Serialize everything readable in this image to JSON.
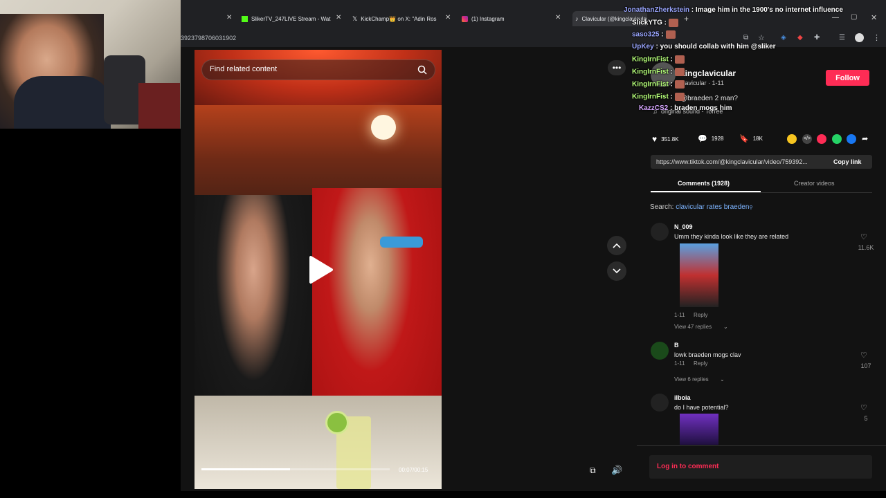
{
  "browser": {
    "tabs": [
      {
        "label": "SlikerTV_247LIVE Stream - Wat",
        "icon": "kick-icon"
      },
      {
        "label": "KickChamp👑 on X: \"Adin Ros",
        "icon": "x-icon"
      },
      {
        "label": "(1) Instagram",
        "icon": "instagram-icon"
      },
      {
        "label": "Clavicular (@kingclavicular)",
        "icon": "tiktok-icon"
      }
    ],
    "url": "3923798706031902"
  },
  "video": {
    "search_placeholder": "Find related content",
    "time": "00:07/00:15",
    "progress_fraction": 0.47
  },
  "post": {
    "username": "kingclavicular",
    "subtitle": "clavicular · 1-11",
    "caption": "@braeden 2 man?",
    "sound": "original sound - Torree",
    "follow_label": "Follow",
    "likes": "351.8K",
    "comments": "1928",
    "saves": "18K",
    "link": "https://www.tiktok.com/@kingclavicular/video/759392...",
    "copy_link_label": "Copy link",
    "tabs": [
      "Comments (1928)",
      "Creator videos"
    ],
    "search_label": "Search:",
    "search_query": "clavicular rates braeden",
    "login_label": "Log in to comment"
  },
  "comments": [
    {
      "name": "N_009",
      "text": "Umm they kinda look like they are related",
      "date": "1-11",
      "reply": "Reply",
      "replies": "View 47 replies",
      "likes": "11.6K"
    },
    {
      "name": "B",
      "text": "lowk braeden mogs clav",
      "date": "1-11",
      "reply": "Reply",
      "replies": "View 6 replies",
      "likes": "107"
    },
    {
      "name": "ilboia",
      "text": "do I have potential?",
      "likes": "5"
    }
  ],
  "chat": [
    {
      "user": "SlickYTG",
      "text": "",
      "color": "#ffffff"
    },
    {
      "user": "JonathanZherkstein",
      "text": "Image him in the 1900's no internet influence",
      "color": "#9aa6ff"
    },
    {
      "user": "saso325",
      "text": "",
      "color": "#9aa6ff"
    },
    {
      "user": "UpKey",
      "text": "you should collab with him @sliker",
      "color": "#9aa6ff"
    },
    {
      "user": "KingIrnFist",
      "text": "",
      "color": "#b6ff7a"
    },
    {
      "user": "KingIrnFist",
      "text": "",
      "color": "#b6ff7a"
    },
    {
      "user": "KingIrnFist",
      "text": "",
      "color": "#b6ff7a"
    },
    {
      "user": "KingIrnFist",
      "text": "",
      "color": "#b6ff7a"
    },
    {
      "user": "KazzCS2",
      "text": "braden mogs him",
      "color": "#d6a6ff"
    }
  ]
}
